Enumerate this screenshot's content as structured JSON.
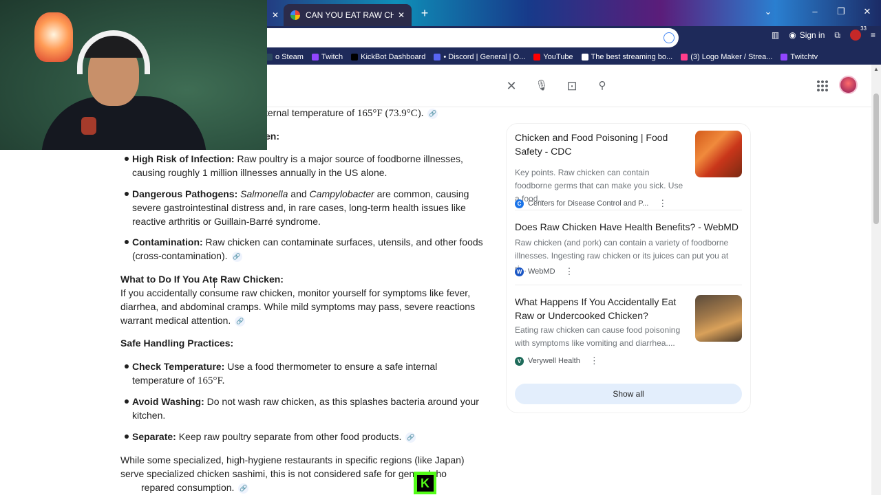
{
  "browser": {
    "active_tab_title": "CAN YOU EAT RAW CHICKEN - G",
    "new_tab_label": "+",
    "sign_in_label": "Sign in",
    "extension_badge": "33",
    "bookmarks": [
      {
        "label": "o Steam",
        "color": "#2a475e"
      },
      {
        "label": "Twitch",
        "color": "#9146ff"
      },
      {
        "label": "KickBot Dashboard",
        "color": "#000000"
      },
      {
        "label": "• Discord | General | O...",
        "color": "#5865f2"
      },
      {
        "label": "YouTube",
        "color": "#ff0000"
      },
      {
        "label": "The best streaming bo...",
        "color": "#ffffff"
      },
      {
        "label": "(3) Logo Maker / Strea...",
        "color": "#ff3d8b"
      },
      {
        "label": "Twitchtv",
        "color": "#9146ff"
      }
    ]
  },
  "article": {
    "partial_line": "ternal temperature of",
    "partial_temp": "165°F (73.9°C).",
    "partial_heading": "en:",
    "risks": [
      {
        "term": "High Risk of Infection:",
        "text": " Raw poultry is a major source of foodborne illnesses, causing roughly 1 million illnesses annually in the US alone."
      },
      {
        "term": "Dangerous Pathogens:",
        "italic1": "Salmonella",
        "mid": " and ",
        "italic2": "Campylobacter",
        "text": " are common, causing severe gastrointestinal distress and, in rare cases, long-term health issues like reactive arthritis or Guillain-Barré syndrome."
      },
      {
        "term": "Contamination:",
        "text": " Raw chicken can contaminate surfaces, utensils, and other foods (cross-contamination)."
      }
    ],
    "what_to_do_heading": "What to Do If You Ate Raw Chicken:",
    "what_to_do_text": "If you accidentally consume raw chicken, monitor yourself for symptoms like fever, diarrhea, and abdominal cramps. While mild symptoms may pass, severe reactions warrant medical attention.",
    "safe_heading": "Safe Handling Practices:",
    "practices": [
      {
        "term": "Check Temperature:",
        "text": " Use a food thermometer to ensure a safe internal temperature of",
        "temp": "165°F."
      },
      {
        "term": "Avoid Washing:",
        "text": " Do not wash raw chicken, as this splashes bacteria around your kitchen."
      },
      {
        "term": "Separate:",
        "text": " Keep raw poultry separate from other food products."
      }
    ],
    "closing": "While some specialized, high-hygiene restaurants in specific regions (like Japan) serve specialized chicken sashimi, this is not considered safe for general, ho",
    "closing_end": "repared",
    "closing_last": "consumption."
  },
  "sources": [
    {
      "title": "Chicken and Food Poisoning | Food Safety - CDC",
      "snippet": "Key points. Raw chicken can contain foodborne germs that can make you sick. Use a food...",
      "source": "Centers for Disease Control and P...",
      "icon_color": "#1a73e8",
      "icon_letter": "C"
    },
    {
      "title": "Does Raw Chicken Have Health Benefits? - WebMD",
      "snippet": "Raw chicken (and pork) can contain a variety of foodborne illnesses. Ingesting raw chicken or its juices can put you at ri...",
      "source": "WebMD",
      "icon_color": "#1a56c4",
      "icon_letter": "W"
    },
    {
      "title": "What Happens If You Accidentally Eat Raw or Undercooked Chicken?",
      "snippet": "Eating raw chicken can cause food poisoning with symptoms like vomiting and diarrhea....",
      "source": "Verywell Health",
      "icon_color": "#1e6b5a",
      "icon_letter": "V"
    }
  ],
  "show_all_label": "Show all",
  "kick_letter": "K",
  "icons": {
    "link": "🔗",
    "clear": "✕",
    "mic": "🎤",
    "lens": "⊡",
    "search": "🔍",
    "more": "⋮"
  }
}
